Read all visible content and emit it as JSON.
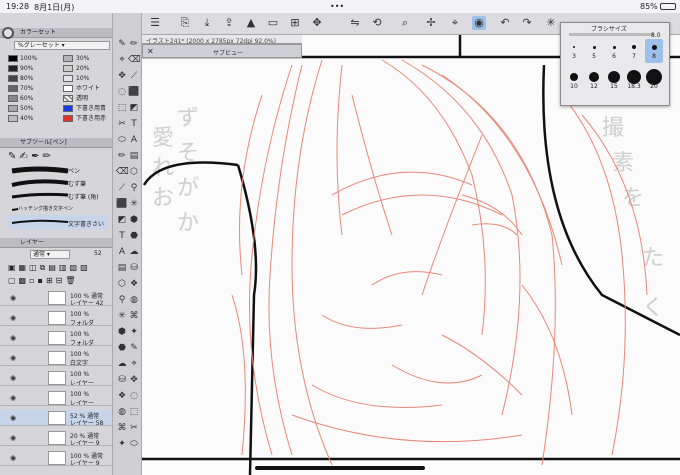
{
  "status": {
    "time": "19:28",
    "date": "8月1日(月)",
    "battery": "85%"
  },
  "color_set": {
    "title": "カラーセット",
    "preset": "%グレーセット",
    "rows": [
      {
        "pct": "100%",
        "pct2": "30%",
        "label2": ""
      },
      {
        "pct": "90%",
        "pct2": "20%",
        "label2": ""
      },
      {
        "pct": "80%",
        "pct2": "10%",
        "label2": ""
      },
      {
        "pct": "70%",
        "pct2": "",
        "label2": "ホワイト"
      },
      {
        "pct": "60%",
        "pct2": "",
        "label2": "透明"
      },
      {
        "pct": "50%",
        "pct2": "",
        "label2": "下書き用青"
      },
      {
        "pct": "40%",
        "pct2": "",
        "label2": "下書き用赤"
      }
    ]
  },
  "subtool": {
    "title": "サブツール[ペン]",
    "brushes": [
      "ペン",
      "むず筆",
      "むず筆 (角)",
      "ハッチング描き文字ペン",
      "文字書きさい"
    ]
  },
  "layers": {
    "title": "レイヤー",
    "blend": "通常",
    "opacity": "52",
    "rows": [
      {
        "t1": "100 % 通常",
        "t2": "レイヤー 42"
      },
      {
        "t1": "100 %",
        "t2": "フォルダ"
      },
      {
        "t1": "100 %",
        "t2": "フォルダ"
      },
      {
        "t1": "100 %",
        "t2": "白文字"
      },
      {
        "t1": "100 %",
        "t2": "レイヤー"
      },
      {
        "t1": "100 %",
        "t2": "レイヤー"
      },
      {
        "t1": "52 % 通常",
        "t2": "レイヤー 58"
      },
      {
        "t1": "20 % 通常",
        "t2": "レイヤー 9"
      },
      {
        "t1": "100 % 通常",
        "t2": "レイヤー 9"
      }
    ]
  },
  "document": {
    "tab": "イラスト241* (2000 x 2785px 72dpi 92.0%)",
    "subview": "サブビュー"
  },
  "brush_size": {
    "title": "ブラシサイズ",
    "value": "8.0",
    "sizes": [
      "3",
      "5",
      "6",
      "7",
      "8",
      "10",
      "12",
      "15",
      "18.3",
      "20"
    ]
  },
  "colors": {
    "sketch_red": "#e7877a",
    "blue_swatch": "#1a3cf0",
    "red_swatch": "#e8302a"
  }
}
